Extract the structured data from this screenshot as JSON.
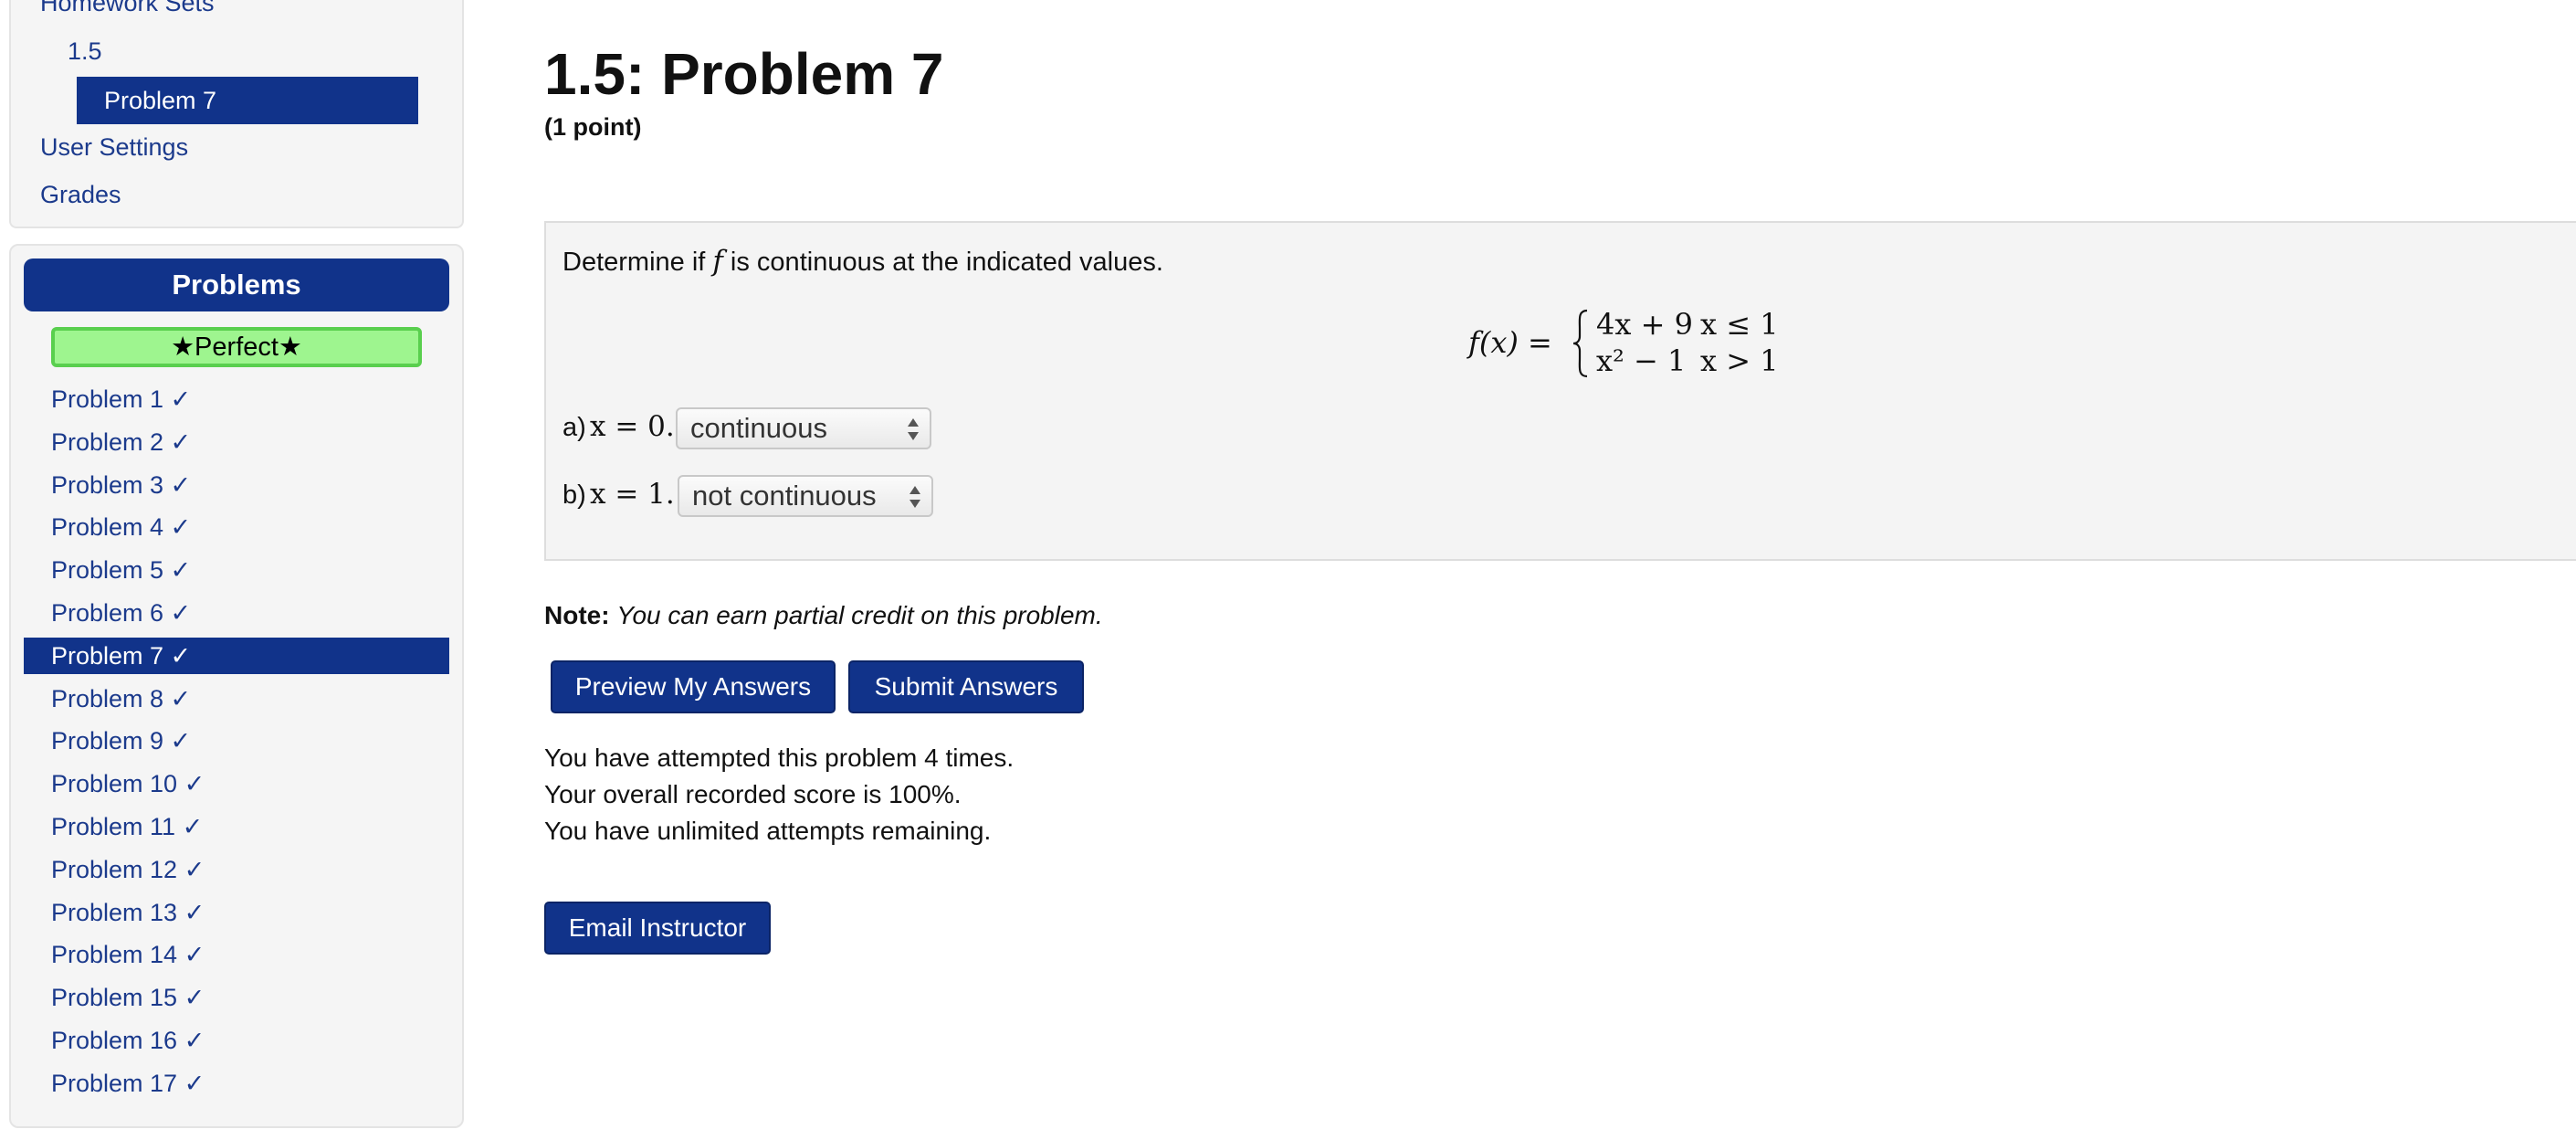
{
  "nav": {
    "homework_sets": "Homework Sets",
    "set": "1.5",
    "current_problem": "Problem 7",
    "user_settings": "User Settings",
    "grades": "Grades"
  },
  "problems_panel": {
    "header": "Problems",
    "badge": "★Perfect★",
    "items": [
      {
        "label": "Problem 1 ✓"
      },
      {
        "label": "Problem 2 ✓"
      },
      {
        "label": "Problem 3 ✓"
      },
      {
        "label": "Problem 4 ✓"
      },
      {
        "label": "Problem 5 ✓"
      },
      {
        "label": "Problem 6 ✓"
      },
      {
        "label": "Problem 7 ✓",
        "current": true
      },
      {
        "label": "Problem 8 ✓"
      },
      {
        "label": "Problem 9 ✓"
      },
      {
        "label": "Problem 10 ✓"
      },
      {
        "label": "Problem 11 ✓"
      },
      {
        "label": "Problem 12 ✓"
      },
      {
        "label": "Problem 13 ✓"
      },
      {
        "label": "Problem 14 ✓"
      },
      {
        "label": "Problem 15 ✓"
      },
      {
        "label": "Problem 16 ✓"
      },
      {
        "label": "Problem 17 ✓"
      }
    ]
  },
  "problem": {
    "title": "1.5: Problem 7",
    "points": "(1 point)",
    "question_prefix": "Determine if ",
    "question_var": "f",
    "question_suffix": " is continuous at the indicated values.",
    "formula": {
      "lhs": "f(x) =",
      "cases": [
        {
          "expr": "4x + 9",
          "cond": "x ≤ 1"
        },
        {
          "expr": "x² − 1",
          "cond": "x > 1"
        }
      ]
    },
    "parts": [
      {
        "label": "a)",
        "math": "x = 0.",
        "selected": "continuous"
      },
      {
        "label": "b)",
        "math": "x = 1.",
        "selected": "not continuous"
      }
    ]
  },
  "note": {
    "label": "Note:",
    "text": "You can earn partial credit on this problem."
  },
  "buttons": {
    "preview": "Preview My Answers",
    "submit": "Submit Answers",
    "email": "Email Instructor"
  },
  "status": {
    "attempts": "You have attempted this problem 4 times.",
    "score": "Your overall recorded score is 100%.",
    "remaining": "You have unlimited attempts remaining."
  },
  "colors": {
    "primary": "#11338a",
    "link": "#1b3a8c",
    "perfect_bg": "#9ef58f",
    "perfect_border": "#59cf4e"
  }
}
